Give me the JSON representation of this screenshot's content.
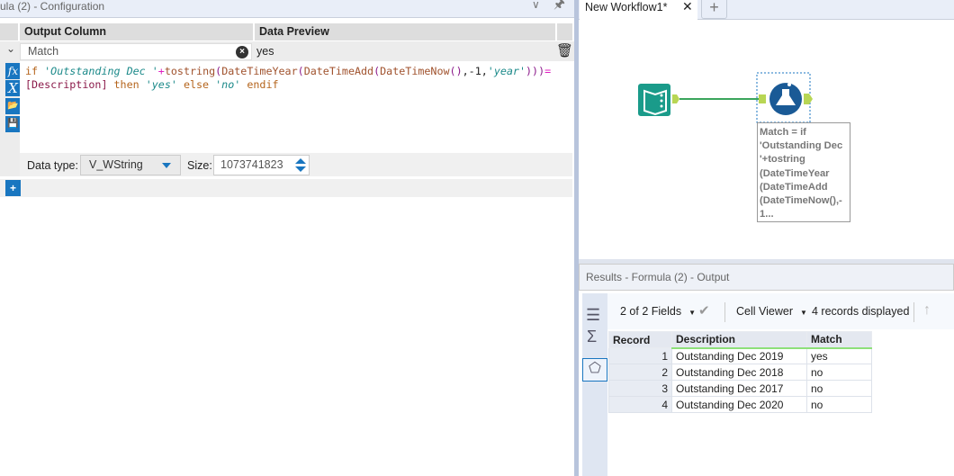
{
  "config": {
    "title": "ula (2) - Configuration",
    "headers": {
      "output_column": "Output Column",
      "data_preview": "Data Preview"
    },
    "row": {
      "output_column": "Match",
      "preview": "yes"
    },
    "formula": [
      {
        "t": "if ",
        "k": "kw"
      },
      {
        "t": "'Outstanding Dec '",
        "k": "str"
      },
      {
        "t": "+",
        "k": "op"
      },
      {
        "t": "tostring",
        "k": "fn"
      },
      {
        "t": "(",
        "k": "par"
      },
      {
        "t": "DateTimeYear",
        "k": "fn"
      },
      {
        "t": "(",
        "k": "par"
      },
      {
        "t": "DateTimeAdd",
        "k": "fn"
      },
      {
        "t": "(",
        "k": "par"
      },
      {
        "t": "DateTimeNow",
        "k": "fn"
      },
      {
        "t": "()",
        "k": "par"
      },
      {
        "t": ",-1,",
        "k": "num"
      },
      {
        "t": "'year'",
        "k": "str"
      },
      {
        "t": ")))",
        "k": "par"
      },
      {
        "t": "=",
        "k": "op"
      },
      {
        "t": "\n",
        "k": "num"
      },
      {
        "t": "[Description]",
        "k": "fld"
      },
      {
        "t": " then ",
        "k": "kw"
      },
      {
        "t": "'yes'",
        "k": "str"
      },
      {
        "t": " else ",
        "k": "kw"
      },
      {
        "t": "'no'",
        "k": "str"
      },
      {
        "t": " endif",
        "k": "kw"
      }
    ],
    "data_type_label": "Data type:",
    "data_type": "V_WString",
    "size_label": "Size:",
    "size": "1073741823"
  },
  "workflow": {
    "tab": "New Workflow1*",
    "annotation": "Match = if 'Outstanding Dec '+tostring (DateTimeYear (DateTimeAdd (DateTimeNow(),- 1..."
  },
  "results": {
    "title": "Results - Formula (2) - Output",
    "fields": "2 of 2 Fields",
    "viewer": "Cell Viewer",
    "count": "4 records displayed",
    "columns": [
      "Record",
      "Description",
      "Match"
    ],
    "rows": [
      [
        "1",
        "Outstanding Dec 2019",
        "yes"
      ],
      [
        "2",
        "Outstanding Dec 2018",
        "no"
      ],
      [
        "3",
        "Outstanding Dec 2017",
        "no"
      ],
      [
        "4",
        "Outstanding Dec 2020",
        "no"
      ]
    ]
  },
  "colors": {
    "accent": "#1976c0",
    "tool_teal": "#1a9b8a",
    "connector": "#b8d654"
  }
}
